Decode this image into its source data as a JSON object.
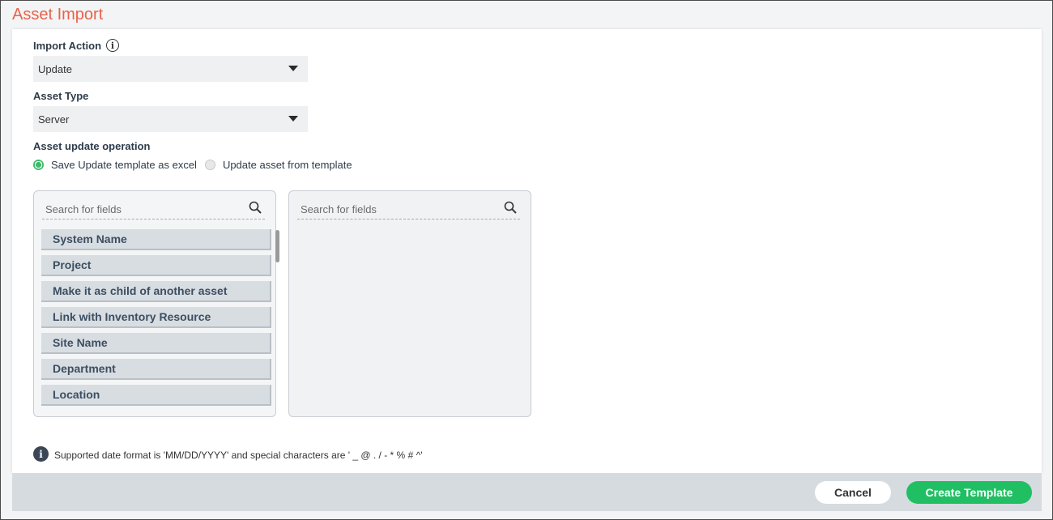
{
  "page": {
    "title": "Asset Import"
  },
  "import_action": {
    "label": "Import Action",
    "value": "Update"
  },
  "asset_type": {
    "label": "Asset Type",
    "value": "Server"
  },
  "update_operation": {
    "label": "Asset update operation",
    "options": [
      {
        "label": "Save Update template as excel",
        "selected": true
      },
      {
        "label": "Update asset from template",
        "selected": false
      }
    ]
  },
  "left_list": {
    "search_placeholder": "Search for fields",
    "items": [
      "System Name",
      "Project",
      "Make it as child of another asset",
      "Link with Inventory Resource",
      "Site Name",
      "Department",
      "Location"
    ]
  },
  "right_list": {
    "search_placeholder": "Search for fields"
  },
  "note": {
    "text": "Supported date format is 'MM/DD/YYYY' and special characters are ' _ @ . / - * % # ^'"
  },
  "footer": {
    "cancel_label": "Cancel",
    "create_label": "Create Template"
  },
  "colors": {
    "accent": "#e8624a",
    "primary": "#21bf63",
    "radio_on": "#3dbd6b"
  }
}
